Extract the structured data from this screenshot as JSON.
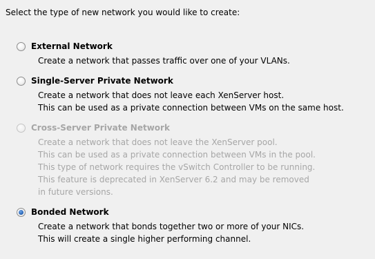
{
  "heading": "Select the type of new network you would like to create:",
  "options": [
    {
      "label": "External Network",
      "lines": [
        "Create a network that passes traffic over one of your VLANs."
      ],
      "checked": false,
      "disabled": false
    },
    {
      "label": "Single-Server Private Network",
      "lines": [
        "Create a network that does not leave each XenServer host.",
        "This can be used as a private connection between VMs on the same host."
      ],
      "checked": false,
      "disabled": false
    },
    {
      "label": "Cross-Server Private Network",
      "lines": [
        "Create a network that does not leave the XenServer pool.",
        "This can be used as a private connection between VMs in the pool.",
        "This type of network requires the vSwitch Controller to be running.",
        "This feature is deprecated in XenServer 6.2 and may be removed",
        "in future versions."
      ],
      "checked": false,
      "disabled": true
    },
    {
      "label": "Bonded Network",
      "lines": [
        "Create a network that bonds together two or more of your NICs.",
        "This will create a single higher performing channel."
      ],
      "checked": true,
      "disabled": false
    }
  ],
  "colors": {
    "background": "#f0f0f0",
    "text": "#000000",
    "disabled_text": "#a6a6a6",
    "radio_selected": "#2a66b8"
  }
}
